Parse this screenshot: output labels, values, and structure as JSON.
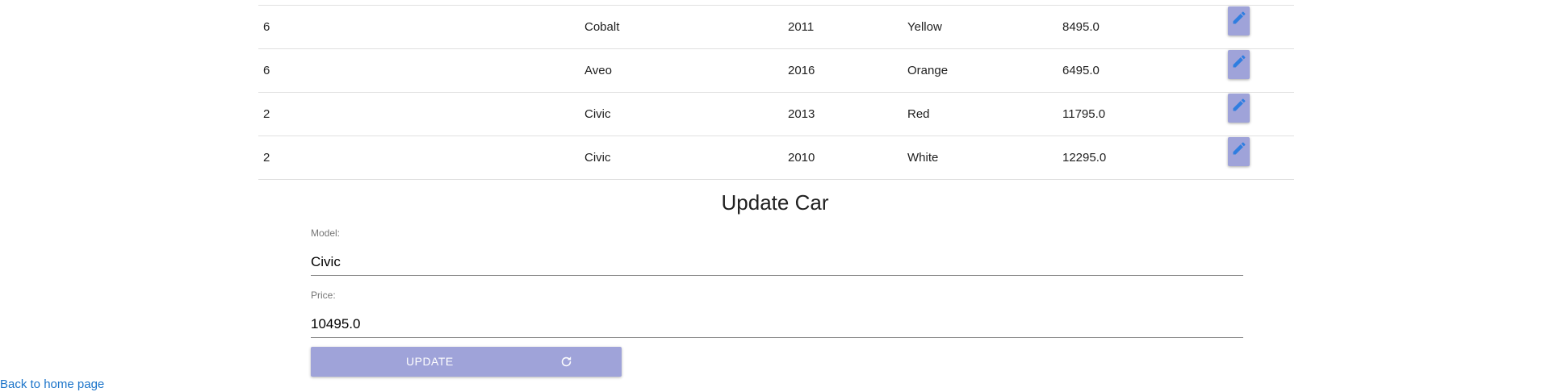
{
  "cars": [
    {
      "id": "6",
      "model": "Cobalt",
      "year": "2011",
      "color": "Yellow",
      "price": "8495.0"
    },
    {
      "id": "6",
      "model": "Aveo",
      "year": "2016",
      "color": "Orange",
      "price": "6495.0"
    },
    {
      "id": "2",
      "model": "Civic",
      "year": "2013",
      "color": "Red",
      "price": "11795.0"
    },
    {
      "id": "2",
      "model": "Civic",
      "year": "2010",
      "color": "White",
      "price": "12295.0"
    }
  ],
  "row_action_icon": "pencil-icon",
  "form": {
    "title": "Update Car",
    "model_label": "Model:",
    "model_value": "Civic",
    "price_label": "Price:",
    "price_value": "10495.0",
    "submit_label": "UPDATE",
    "submit_icon": "refresh-icon"
  },
  "footer": {
    "home_link": "Back to home page"
  },
  "colors": {
    "button_bg": "#9fa3d9",
    "edit_icon": "#2f7ee0",
    "link": "#1a73c9"
  }
}
